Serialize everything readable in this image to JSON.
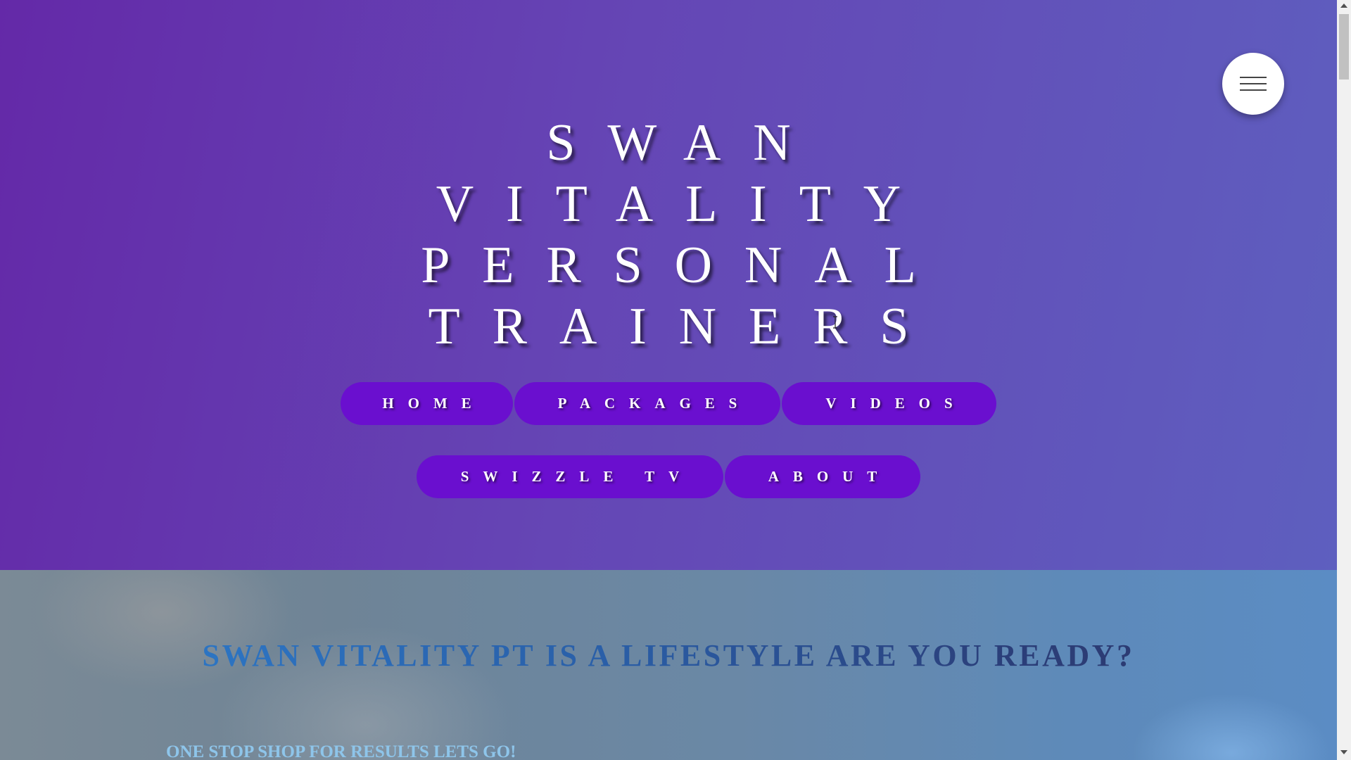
{
  "hero": {
    "title_lines": [
      "SWAN",
      "VITALITY",
      "PERSONAL",
      "TRAINERS"
    ],
    "nav": [
      {
        "label": "HOME"
      },
      {
        "label": "PACKAGES"
      },
      {
        "label": "VIDEOS"
      },
      {
        "label": "SWIZZLE TV"
      },
      {
        "label": "ABOUT"
      }
    ],
    "menu_icon": "hamburger-menu-icon",
    "colors": {
      "background_start": "#6429a8",
      "background_end": "#5e5fbf",
      "nav_button": "#6a0fcf",
      "title_text": "#ffffff"
    }
  },
  "section2": {
    "tagline": "SWAN VITALITY PT IS A LIFESTYLE ARE YOU READY?",
    "subtagline": "ONE STOP SHOP FOR RESULTS LETS GO!",
    "colors": {
      "tagline_start": "#2d7fd0",
      "tagline_end": "#2e3568",
      "subtagline": "#8ec5ea"
    }
  }
}
